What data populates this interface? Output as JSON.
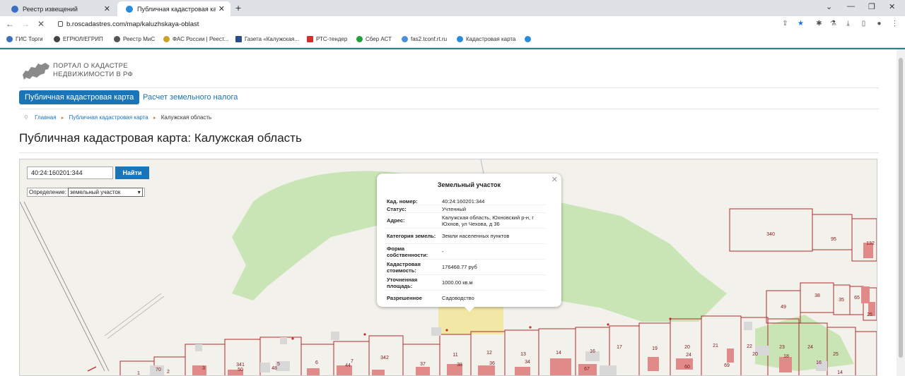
{
  "browser": {
    "tabs": [
      {
        "label": "Реестр извещений",
        "active": false
      },
      {
        "label": "Публичная кадастровая карта: К",
        "active": true
      }
    ],
    "url": "b.roscadastres.com/map/kaluzhskaya-oblast",
    "bookmarks": [
      "ГИС Торги",
      "ЕГРЮЛ/ЕГРИП",
      "Реестр МиС",
      "ФАС России | Реест...",
      "Газета «Калужская...",
      "РТС-тендер",
      "Сбер АСТ",
      "fas2.tconf.rt.ru",
      "Кадастровая карта"
    ]
  },
  "site": {
    "logo_line1": "ПОРТАЛ О КАДАСТРЕ",
    "logo_line2": "НЕДВИЖИМОСТИ В РФ",
    "nav": [
      "Публичная кадастровая карта",
      "Расчет земельного налога"
    ],
    "breadcrumb": [
      "Главная",
      "Публичная кадастровая карта",
      "Калужская область"
    ],
    "page_title": "Публичная кадастровая карта: Калужская область"
  },
  "map": {
    "search_value": "40:24:160201:344",
    "search_button": "Найти",
    "definition_label": "Определение:",
    "definition_value": "земельный участок",
    "parcel_labels": [
      "340",
      "95",
      "132",
      "49",
      "38",
      "35",
      "65",
      "25",
      "1",
      "70",
      "2",
      "3",
      "341",
      "50",
      "48",
      "5",
      "6",
      "44",
      "7",
      "342",
      "37",
      "11",
      "38",
      "12",
      "36",
      "13",
      "34",
      "14",
      "16",
      "17",
      "19",
      "20",
      "21",
      "22",
      "23",
      "24",
      "25",
      "16",
      "14",
      "18",
      "20",
      "24",
      "60",
      "69",
      "67"
    ]
  },
  "popup": {
    "title": "Земельный участок",
    "rows": [
      {
        "k": "Кад. номер:",
        "v": "40:24:160201:344"
      },
      {
        "k": "Статус:",
        "v": "Учтенный"
      },
      {
        "k": "Адрес:",
        "v": "Калужская область, Юхновский р-н, г Юхнов, ул Чехова, д 36"
      },
      {
        "k": "Категория земель:",
        "v": "Земли населенных пунктов"
      },
      {
        "k": "Форма собственности:",
        "v": "-"
      },
      {
        "k": "Кадастровая стоимость:",
        "v": "176468.77 руб"
      },
      {
        "k": "Уточненная площадь:",
        "v": "1000.00 кв.м"
      },
      {
        "k": "Разрешенное",
        "v": "Садоводство"
      }
    ]
  }
}
